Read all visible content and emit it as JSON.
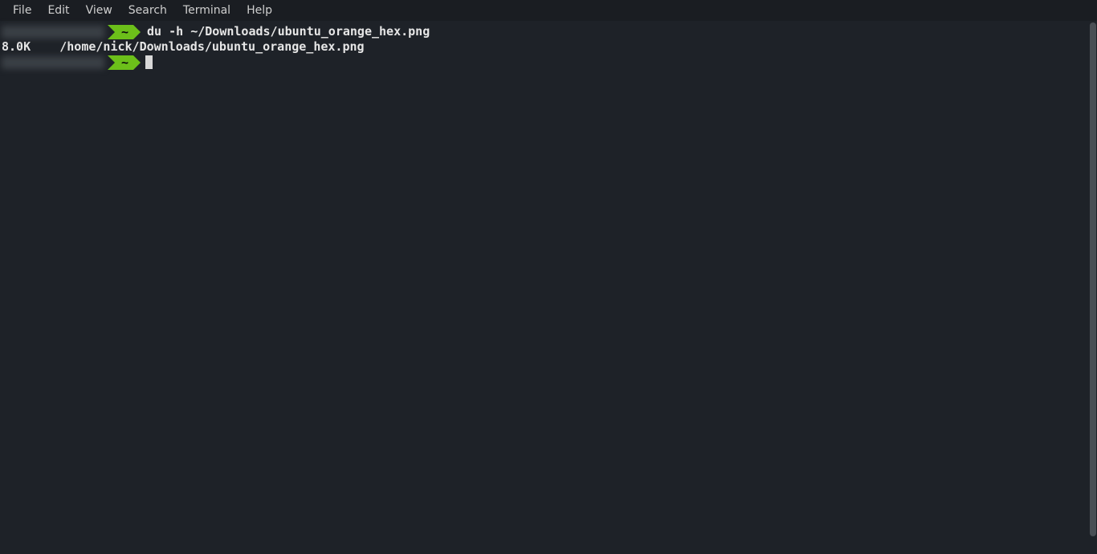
{
  "menubar": {
    "items": [
      "File",
      "Edit",
      "View",
      "Search",
      "Terminal",
      "Help"
    ]
  },
  "prompt": {
    "dir_symbol": "~"
  },
  "lines": {
    "command": "du -h ~/Downloads/ubuntu_orange_hex.png",
    "output": "8.0K\t/home/nick/Downloads/ubuntu_orange_hex.png"
  },
  "colors": {
    "bg": "#1e2228",
    "prompt_green": "#6cbf1a",
    "text": "#e6e6e6"
  }
}
